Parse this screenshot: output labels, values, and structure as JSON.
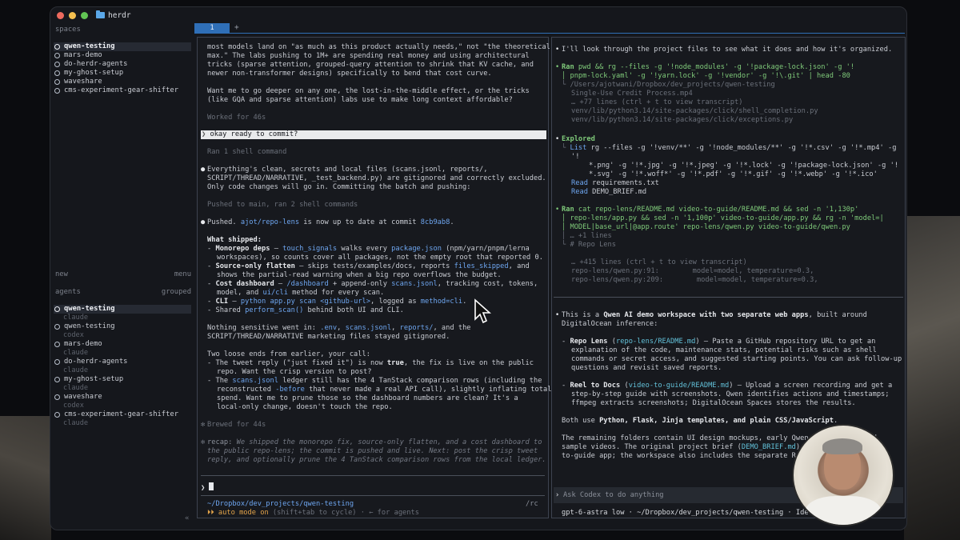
{
  "window": {
    "title": "herdr"
  },
  "sidebar": {
    "spaces_label": "spaces",
    "spaces": [
      {
        "name": "qwen-testing",
        "selected": true
      },
      {
        "name": "mars-demo",
        "selected": false
      },
      {
        "name": "do-herdr-agents",
        "selected": false
      },
      {
        "name": "my-ghost-setup",
        "selected": false
      },
      {
        "name": "waveshare",
        "selected": false
      },
      {
        "name": "cms-experiment-gear-shifter",
        "selected": false
      }
    ],
    "new_label": "new",
    "menu_label": "menu",
    "agents_label": "agents",
    "grouped_label": "grouped",
    "agents": [
      {
        "name": "qwen-testing",
        "agent": "claude",
        "selected": true
      },
      {
        "name": "qwen-testing",
        "agent": "codex",
        "selected": false
      },
      {
        "name": "mars-demo",
        "agent": "claude",
        "selected": false
      },
      {
        "name": "do-herdr-agents",
        "agent": "claude",
        "selected": false
      },
      {
        "name": "my-ghost-setup",
        "agent": "claude",
        "selected": false
      },
      {
        "name": "waveshare",
        "agent": "codex",
        "selected": false
      },
      {
        "name": "cms-experiment-gear-shifter",
        "agent": "claude",
        "selected": false
      }
    ],
    "collapse_glyph": "«"
  },
  "tabs": {
    "active_label": "1",
    "add_label": "+"
  },
  "claude_pane": {
    "intro1": "most models land on \"as much as this product actually needs,\" not \"the theoretical",
    "intro2": "max.\" The labs pushing to 1M+ are spending real money and using architectural",
    "intro3": "tricks (sparse attention, grouped-query attention to shrink that KV cache, and",
    "intro4": "newer non-transformer designs) specifically to bend that cost curve.",
    "intro5": "Want me to go deeper on any one, the lost-in-the-middle effect, or the tricks",
    "intro6": "(like GQA and sparse attention) labs use to make long context affordable?",
    "worked": "Worked for 46s",
    "user_prompt": "okay ready to commit?",
    "ran_shell": "Ran 1 shell command",
    "everything1": "Everything's clean, secrets and local files (scans.jsonl, reports/,",
    "everything2": "SCRIPT/THREAD/NARRATIVE, _test_backend.py) are gitignored and correctly excluded.",
    "everything3": "Only code changes will go in. Committing the batch and pushing:",
    "pushed_main": "Pushed to main, ran 2 shell commands",
    "pushed_a": "Pushed. ",
    "pushed_repo": "ajot/repo-lens",
    "pushed_b": " is now up to date at commit ",
    "pushed_commit": "8cb9ab8",
    "pushed_c": ".",
    "what_shipped": "What shipped:",
    "ms1_a": "Monorepo deps",
    "ms1_b": " — ",
    "ms1_c": "touch_signals",
    "ms1_d": " walks every ",
    "ms1_e": "package.json",
    "ms1_f": " (npm/yarn/pnpm/lerna",
    "ms2": "workspaces), so counts cover all packages, not the empty root that reported 0.",
    "sf1_a": "Source-only flatten",
    "sf1_b": " — skips tests/examples/docs, reports ",
    "sf1_c": "files_skipped",
    "sf1_d": ", and",
    "sf2": "shows the partial-read warning when a big repo overflows the budget.",
    "cd1_a": "Cost dashboard",
    "cd1_b": " — ",
    "cd1_c": "/dashboard",
    "cd1_d": " + append-only ",
    "cd1_e": "scans.jsonl",
    "cd1_f": ", tracking cost, tokens,",
    "cd2_a": "model, and ",
    "cd2_b": "ui/cli",
    "cd2_c": " method for every scan.",
    "cli_a": "CLI",
    "cli_b": " — ",
    "cli_c": "python app.py scan <github-url>",
    "cli_d": ", logged as ",
    "cli_e": "method=cli",
    "cli_f": ".",
    "sh_a": "Shared ",
    "sh_b": "perform_scan()",
    "sh_c": " behind both UI and CLI.",
    "ns1_a": "Nothing sensitive went in: ",
    "ns1_b": ".env",
    "ns1_c": ", ",
    "ns1_d": "scans.jsonl",
    "ns1_e": ", ",
    "ns1_f": "reports/",
    "ns1_g": ", and the",
    "ns2": "SCRIPT/THREAD/NARRATIVE marketing files stayed gitignored.",
    "loose": "Two loose ends from earlier, your call:",
    "le1_a": "The tweet reply (\"just fixed it\") is now ",
    "le1_b": "true",
    "le1_c": ", the fix is live on the public",
    "le2": "repo. Want the crisp version to post?",
    "le3_a": "The ",
    "le3_b": "scans.jsonl",
    "le3_c": " ledger still has the 4 TanStack comparison rows (including the",
    "le4_a": "reconstructed ",
    "le4_b": "-before",
    "le4_c": " that never made a real API call), slightly inflating total",
    "le5": "spend. Want me to prune those so the dashboard numbers are clean? It's a",
    "le6": "local-only change, doesn't touch the repo.",
    "brewed": "Brewed for 44s",
    "recap_label": "recap:",
    "recap1": " We shipped the monorepo fix, source-only flatten, and a cost dashboard to",
    "recap2": "the public repo-lens; the commit is pushed and live. Next: post the crisp tweet",
    "recap3": "reply, and optionally prune the 4 TanStack comparison rows from the local ledger.",
    "prompt_glyph": "❯",
    "footer_path": "~/Dropbox/dev_projects/qwen-testing",
    "footer_rc": "/rc",
    "auto_mode_glyph": "⏵⏵",
    "auto_mode_a": "auto mode on",
    "auto_mode_b": " (shift+tab to cycle) · ← for agents"
  },
  "codex_pane": {
    "l1": "I'll look through the project files to see what it does and how it's organized.",
    "ran1_label": "Ran",
    "ran1_cmd": " pwd && rg --files -g '!node_modules' -g '!package-lock.json' -g '!",
    "ran1_cmd2": "pnpm-lock.yaml' -g '!yarn.lock' -g '!vendor' -g '!\\.git' | head -80",
    "out1": "/Users/ajotwani/Dropbox/dev_projects/qwen-testing",
    "out2": "Single-Use Credit Process.mp4",
    "out3": "… +77 lines (ctrl + t to view transcript)",
    "out4": "venv/lib/python3.14/site-packages/click/shell_completion.py",
    "out5": "venv/lib/python3.14/site-packages/click/exceptions.py",
    "explored": "Explored",
    "ex1_label": "List",
    "ex1": " rg --files -g '!venv/**' -g '!node_modules/**' -g '!*.csv' -g '!*.mp4' -g",
    "ex1b": "'!",
    "ex2": "*.png' -g '!*.jpg' -g '!*.jpeg' -g '!*.lock' -g '!package-lock.json' -g '!",
    "ex3": "*.svg' -g '!*.woff*' -g '!*.pdf' -g '!*.gif' -g '!*.webp' -g '!*.ico'",
    "ex4_label": "Read",
    "ex4": " requirements.txt",
    "ex5_label": "Read",
    "ex5": " DEMO_BRIEF.md",
    "ran2_label": "Ran",
    "ran2_cmd": " cat repo-lens/README.md video-to-guide/README.md && sed -n '1,130p'",
    "ran2_cmd2": "repo-lens/app.py && sed -n '1,100p' video-to-guide/app.py && rg -n 'model=|",
    "ran2_cmd3": "MODEL|base_url|@app.route' repo-lens/qwen.py video-to-guide/qwen.py",
    "out6": "… +1 lines",
    "out7": "# Repo Lens",
    "out8": "… +415 lines (ctrl + t to view transcript)",
    "out9": "repo-lens/qwen.py:91:        model=model, temperature=0.3,",
    "out10": "repo-lens/qwen.py:209:        model=model, temperature=0.3,",
    "sum1_a": "This is a ",
    "sum1_b": "Qwen AI demo workspace with two separate web apps",
    "sum1_c": ", built around",
    "sum2": "DigitalOcean inference:",
    "rl1_a": "Repo Lens",
    "rl1_b": " (",
    "rl1_c": "repo-lens/README.md",
    "rl1_d": ") — Paste a GitHub repository URL to get an",
    "rl2": "explanation of the code, maintenance stats, potential risks such as shell",
    "rl3": "commands or secret access, and suggested starting points. You can ask follow-up",
    "rl4": "questions and revisit saved reports.",
    "rd1_a": "Reel to Docs",
    "rd1_b": " (",
    "rd1_c": "video-to-guide/README.md",
    "rd1_d": ") — Upload a screen recording and get a",
    "rd2": "step-by-step guide with screenshots. Qwen identifies actions and timestamps;",
    "rd3": "ffmpeg extracts screenshots; DigitalOcean Spaces stores the results.",
    "both_a": "Both use ",
    "both_b": "Python, Flask, Jinja templates, and plain CSS/JavaScript",
    "both_c": ".",
    "rem1": "The remaining folders contain UI design mockups, early Qwen expe",
    "rem1b": "d",
    "rem2": "sample videos. The original project brief (",
    "rem2_b": "DEMO_BRIEF.md",
    "rem2_c": ") fo",
    "rem2_d": "-",
    "rem3": "to-guide app; the workspace also includes the separate Rep",
    "input_placeholder": "Ask Codex to do anything",
    "status": "gpt-6-astra low · ~/Dropbox/dev_projects/qwen-testing · Ide"
  },
  "colors": {
    "accent": "#2f6fb7",
    "selected_bg": "#262a33",
    "ran_green": "#7fca7a",
    "link_blue": "#6ea6f0"
  }
}
